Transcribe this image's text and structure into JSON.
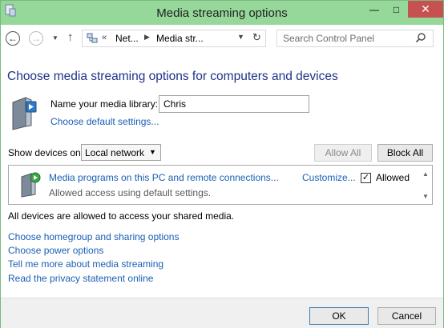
{
  "window": {
    "title": "Media streaming options",
    "minimize_glyph": "—",
    "maximize_glyph": "□",
    "close_glyph": "✕"
  },
  "nav": {
    "back_icon": "back-arrow-icon",
    "forward_icon": "forward-arrow-icon",
    "up_icon": "up-arrow-icon",
    "breadcrumb_overflow": "«",
    "breadcrumb": [
      "Net...",
      "Media str..."
    ],
    "refresh_icon": "refresh-icon",
    "search_placeholder": "Search Control Panel"
  },
  "main": {
    "heading": "Choose media streaming options for computers and devices",
    "library_label": "Name your media library:",
    "library_name": "Chris",
    "default_settings_link": "Choose default settings...",
    "show_devices_label": "Show devices on:",
    "show_devices_value": "Local network",
    "allow_all_label": "Allow All",
    "block_all_label": "Block All",
    "device": {
      "name": "Media programs on this PC and remote connections...",
      "status": "Allowed access using default settings.",
      "customize_label": "Customize...",
      "allowed_label": "Allowed",
      "allowed_checked": true
    },
    "all_allowed_text": "All devices are allowed to access your shared media.",
    "links": [
      "Choose homegroup and sharing options",
      "Choose power options",
      "Tell me more about media streaming",
      "Read the privacy statement online"
    ]
  },
  "footer": {
    "ok_label": "OK",
    "cancel_label": "Cancel"
  },
  "colors": {
    "titlebar": "#96d89a",
    "heading": "#1e3287",
    "link": "#1a5fb4",
    "close_button": "#c75050"
  }
}
